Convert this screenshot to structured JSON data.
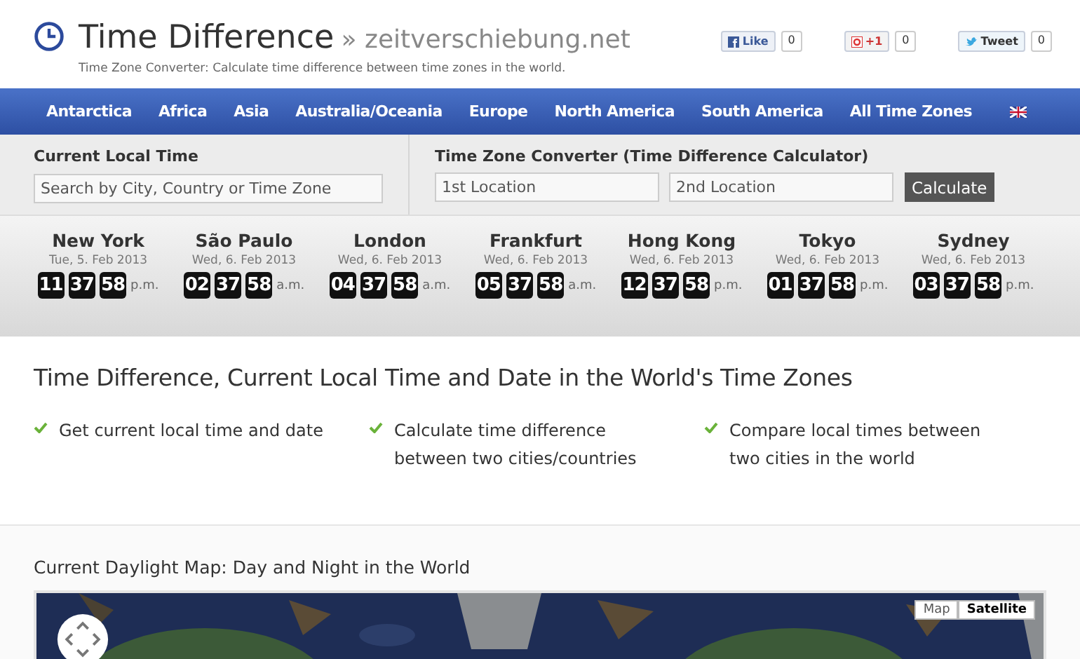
{
  "header": {
    "title": "Time Difference",
    "domain": "» zeitverschiebung.net",
    "subtitle": "Time Zone Converter: Calculate time difference between time zones in the world.",
    "social": [
      {
        "kind": "facebook",
        "label": "Like",
        "count": "0"
      },
      {
        "kind": "google",
        "label": "+1",
        "count": "0"
      },
      {
        "kind": "twitter",
        "label": "Tweet",
        "count": "0"
      }
    ]
  },
  "nav": {
    "items": [
      "Antarctica",
      "Africa",
      "Asia",
      "Australia/Oceania",
      "Europe",
      "North America",
      "South America",
      "All Time Zones"
    ]
  },
  "local": {
    "label": "Current Local Time",
    "placeholder": "Search by City, Country or Time Zone"
  },
  "converter": {
    "label": "Time Zone Converter (Time Difference Calculator)",
    "first": {
      "placeholder": "1st Location"
    },
    "second": {
      "placeholder": "2nd Location"
    },
    "button": "Calculate"
  },
  "clocks": [
    {
      "city": "New York",
      "date": "Tue, 5. Feb 2013",
      "h": "11",
      "m": "37",
      "s": "58",
      "ampm": "p.m."
    },
    {
      "city": "São Paulo",
      "date": "Wed, 6. Feb 2013",
      "h": "02",
      "m": "37",
      "s": "58",
      "ampm": "a.m."
    },
    {
      "city": "London",
      "date": "Wed, 6. Feb 2013",
      "h": "04",
      "m": "37",
      "s": "58",
      "ampm": "a.m."
    },
    {
      "city": "Frankfurt",
      "date": "Wed, 6. Feb 2013",
      "h": "05",
      "m": "37",
      "s": "58",
      "ampm": "a.m."
    },
    {
      "city": "Hong Kong",
      "date": "Wed, 6. Feb 2013",
      "h": "12",
      "m": "37",
      "s": "58",
      "ampm": "p.m."
    },
    {
      "city": "Tokyo",
      "date": "Wed, 6. Feb 2013",
      "h": "01",
      "m": "37",
      "s": "58",
      "ampm": "p.m."
    },
    {
      "city": "Sydney",
      "date": "Wed, 6. Feb 2013",
      "h": "03",
      "m": "37",
      "s": "58",
      "ampm": "p.m."
    }
  ],
  "intro": {
    "heading": "Time Difference, Current Local Time and Date in the World's Time Zones",
    "features": [
      "Get current local time and date",
      "Calculate time difference between two cities/countries",
      "Compare local times between two cities in the world"
    ]
  },
  "map": {
    "heading": "Current Daylight Map: Day and Night in the World",
    "types": [
      {
        "label": "Map",
        "selected": false
      },
      {
        "label": "Satellite",
        "selected": true
      }
    ]
  }
}
